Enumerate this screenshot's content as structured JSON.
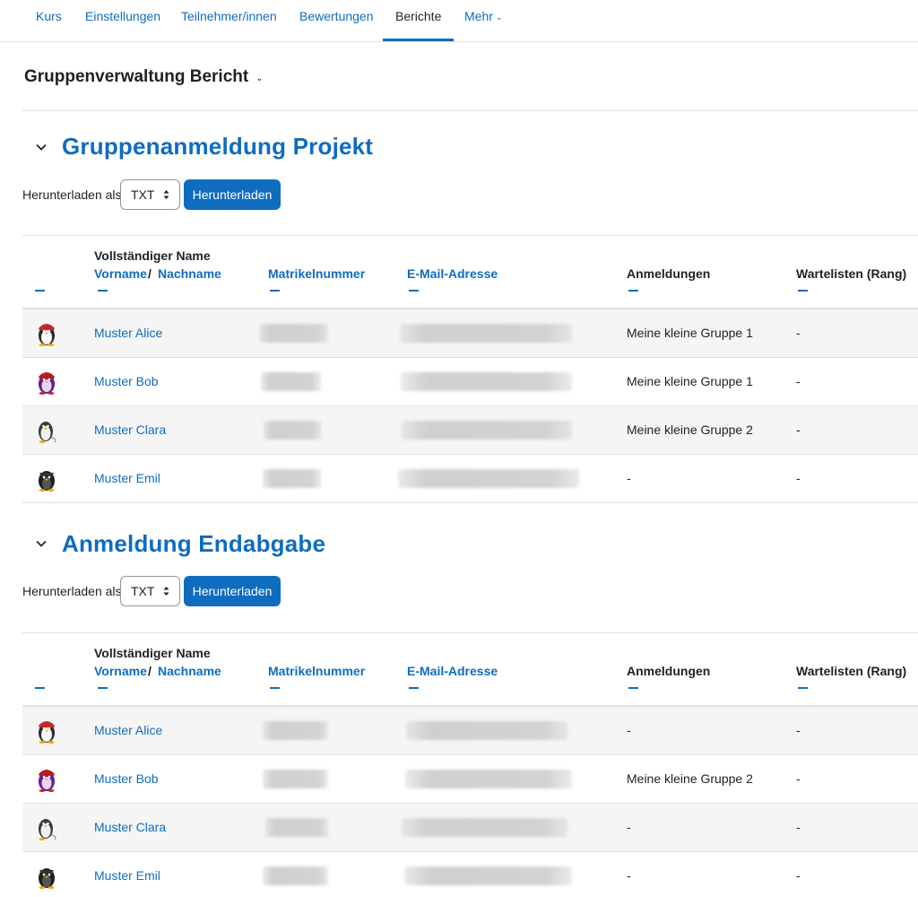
{
  "nav": {
    "items": [
      {
        "label": "Kurs"
      },
      {
        "label": "Einstellungen"
      },
      {
        "label": "Teilnehmer/innen"
      },
      {
        "label": "Bewertungen"
      },
      {
        "label": "Berichte",
        "active": true
      },
      {
        "label": "Mehr"
      }
    ]
  },
  "report_selector": {
    "label": "Gruppenverwaltung Bericht"
  },
  "colors": {
    "accent": "#0f6cbf",
    "text": "#1d2125",
    "stripe": "#f5f5f5",
    "border": "#dee2e6"
  },
  "columns": {
    "fullname": "Vollständiger Name",
    "firstname": "Vorname",
    "separator": "/",
    "lastname": "Nachname",
    "idnumber": "Matrikelnummer",
    "email": "E-Mail-Adresse",
    "registrations": "Anmeldungen",
    "waitlist": "Wartelisten (Rang)"
  },
  "sections": [
    {
      "title": "Gruppenanmeldung Projekt",
      "download_label": "Herunterladen als",
      "format_value": "TXT",
      "download_button": "Herunterladen",
      "rows": [
        {
          "avatar": "penguin-avatar-red-white",
          "name": "Muster Alice",
          "registrations": "Meine kleine Gruppe 1",
          "waitlist": "-"
        },
        {
          "avatar": "penguin-avatar-red-purple",
          "name": "Muster Bob",
          "registrations": "Meine kleine Gruppe 1",
          "waitlist": "-"
        },
        {
          "avatar": "penguin-avatar-grey",
          "name": "Muster Clara",
          "registrations": "Meine kleine Gruppe 2",
          "waitlist": "-"
        },
        {
          "avatar": "penguin-avatar-dark",
          "name": "Muster Emil",
          "registrations": "-",
          "waitlist": "-"
        }
      ]
    },
    {
      "title": "Anmeldung Endabgabe",
      "download_label": "Herunterladen als",
      "format_value": "TXT",
      "download_button": "Herunterladen",
      "rows": [
        {
          "avatar": "penguin-avatar-red-white",
          "name": "Muster Alice",
          "registrations": "-",
          "waitlist": "-"
        },
        {
          "avatar": "penguin-avatar-red-purple",
          "name": "Muster Bob",
          "registrations": "Meine kleine Gruppe 2",
          "waitlist": "-"
        },
        {
          "avatar": "penguin-avatar-grey",
          "name": "Muster Clara",
          "registrations": "-",
          "waitlist": "-"
        },
        {
          "avatar": "penguin-avatar-dark",
          "name": "Muster Emil",
          "registrations": "-",
          "waitlist": "-"
        }
      ]
    }
  ]
}
